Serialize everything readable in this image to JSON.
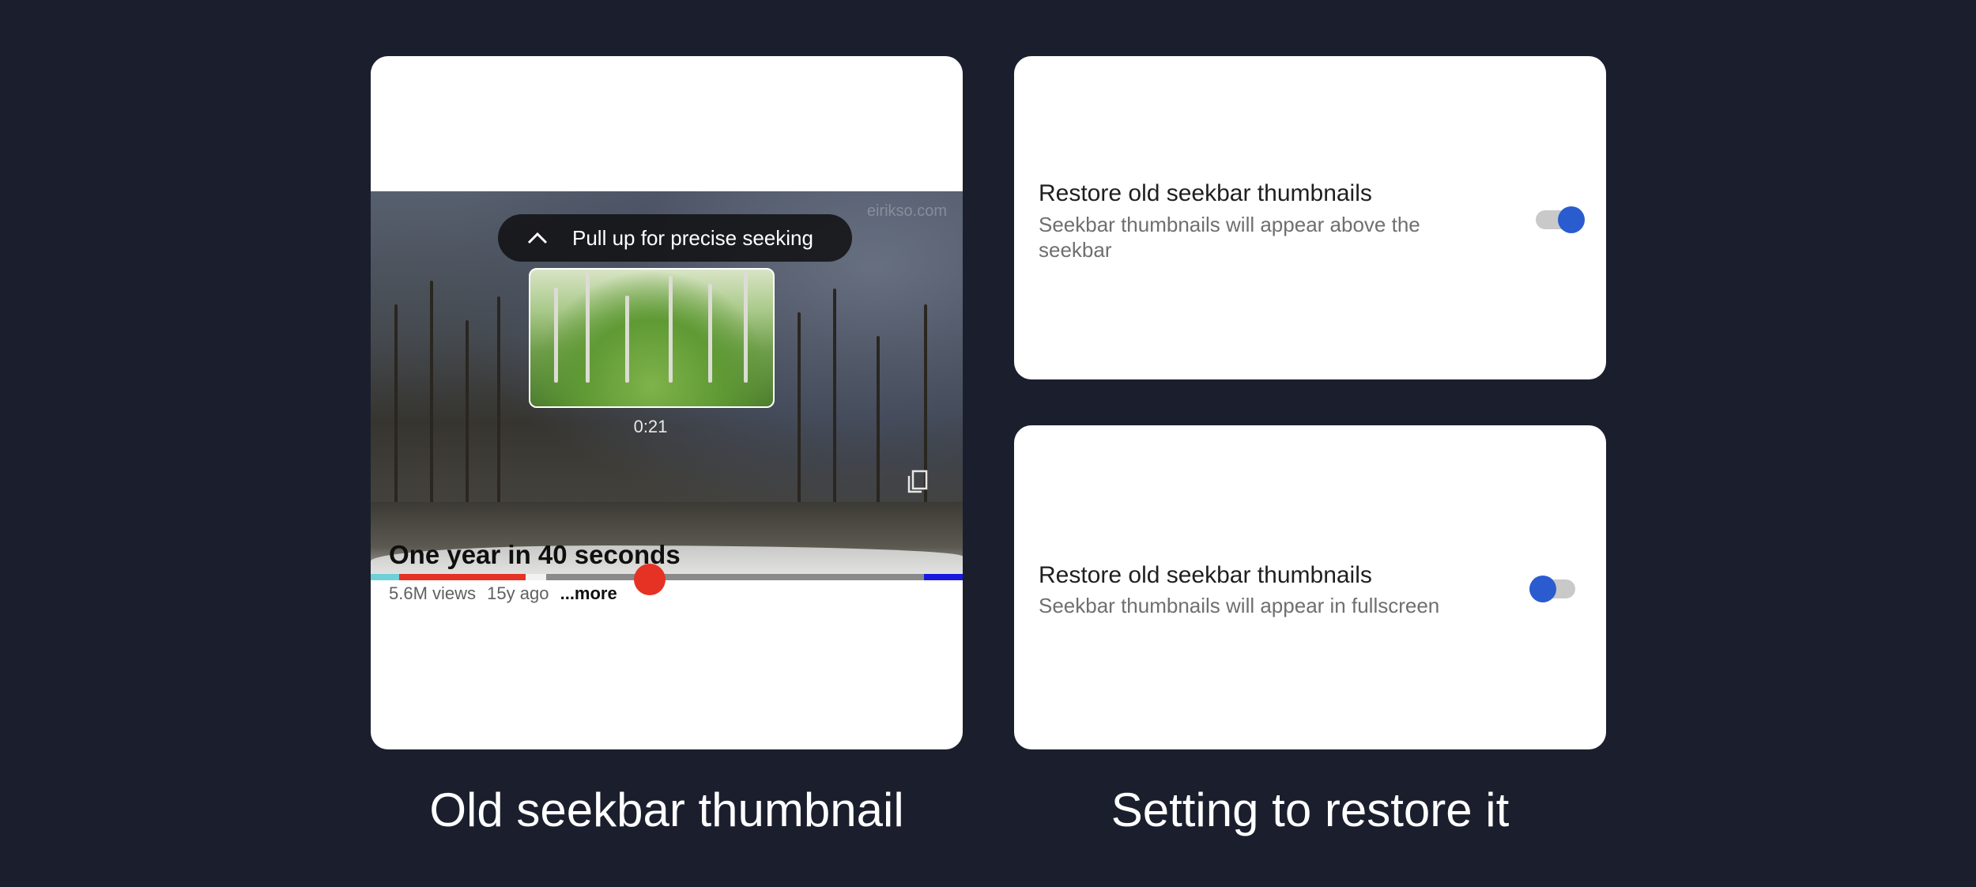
{
  "player_card": {
    "overlay": {
      "pull_up_hint": "Pull up for precise seeking",
      "preview_time": "0:21"
    },
    "video": {
      "title": "One year in 40 seconds",
      "views": "5.6M views",
      "age": "15y ago",
      "more_label": "...more"
    },
    "watermark": "eirikso.com",
    "seekbar": {
      "colors": {
        "played": "#e53224",
        "thumb": "#e53224",
        "track": "#8a8a8a",
        "chapter_start": "#6fd0d8",
        "end_marker": "#1a1adf"
      }
    }
  },
  "settings": [
    {
      "title": "Restore old seekbar thumbnails",
      "description": "Seekbar thumbnails will appear above the seekbar",
      "enabled": true
    },
    {
      "title": "Restore old seekbar thumbnails",
      "description": "Seekbar thumbnails will appear in fullscreen",
      "enabled": false
    }
  ],
  "captions": {
    "left": "Old seekbar thumbnail",
    "right": "Setting to restore it"
  },
  "colors": {
    "background": "#1b1f2d",
    "toggle_accent": "#2a5ccf",
    "toggle_track": "#c9c9c9"
  }
}
